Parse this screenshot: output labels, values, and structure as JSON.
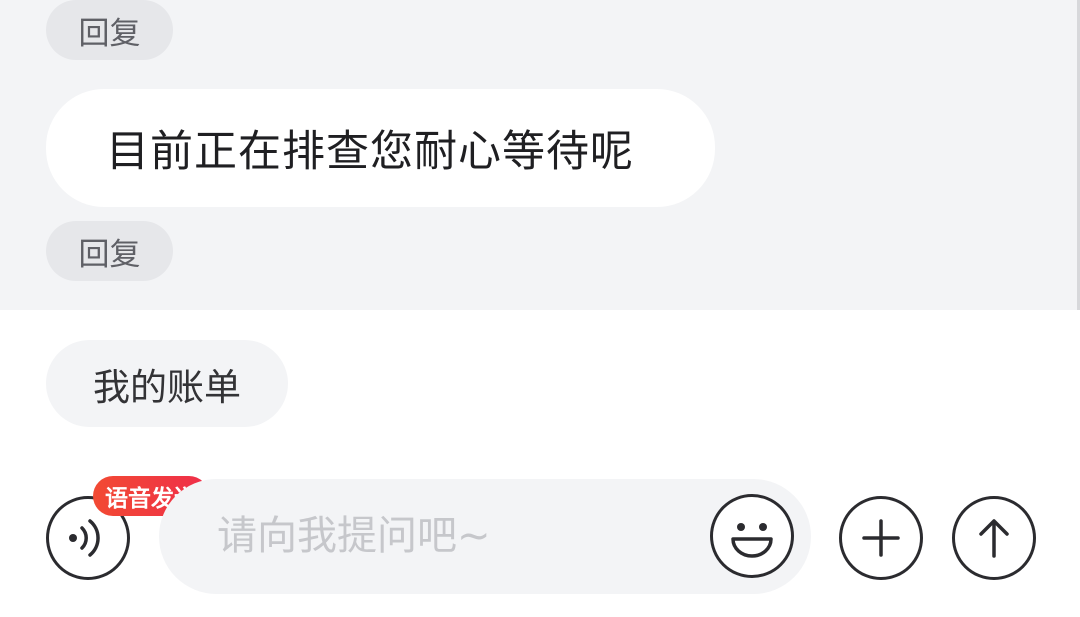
{
  "chat": {
    "reply_label_1": "回复",
    "message_text": "目前正在排查您耐心等待呢",
    "reply_label_2": "回复"
  },
  "quick_actions": {
    "my_bill": "我的账单"
  },
  "composer": {
    "voice_badge": "语音发送",
    "input_placeholder": "请向我提问吧~",
    "icons": {
      "voice": "voice-wave-icon",
      "emoji": "smile-icon",
      "add": "plus-icon",
      "send": "arrow-up-icon"
    }
  },
  "colors": {
    "chat_background": "#f3f4f6",
    "badge_red": "#f03c3c",
    "icon_stroke": "#2b2b2f"
  }
}
